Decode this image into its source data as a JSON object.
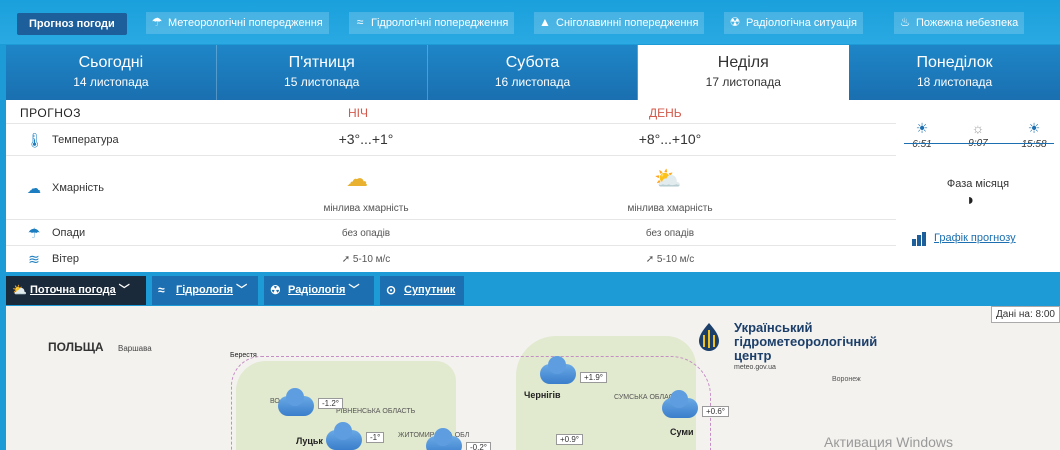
{
  "top_nav": {
    "active_label": "Прогноз погоди",
    "warnings": [
      {
        "label": "Метеорологічні попередження",
        "icon": "weather-warning-icon"
      },
      {
        "label": "Гідрологічні попередження",
        "icon": "hydro-warning-icon"
      },
      {
        "label": "Сніголавинні попередження",
        "icon": "avalanche-warning-icon"
      },
      {
        "label": "Радіологічна ситуація",
        "icon": "radiation-icon"
      },
      {
        "label": "Пожежна небезпека",
        "icon": "fire-danger-icon"
      }
    ]
  },
  "days": [
    {
      "name": "Сьогодні",
      "date": "14 листопада"
    },
    {
      "name": "П'ятниця",
      "date": "15 листопада"
    },
    {
      "name": "Субота",
      "date": "16 листопада"
    },
    {
      "name": "Неділя",
      "date": "17 листопада"
    },
    {
      "name": "Понеділок",
      "date": "18 листопада"
    }
  ],
  "selected_day_index": 3,
  "forecast": {
    "label": "ПРОГНОЗ",
    "night_label": "НІЧ",
    "day_label": "ДЕНЬ",
    "rows": {
      "temperature": {
        "name": "Температура",
        "night": "+3°...+1°",
        "day": "+8°...+10°"
      },
      "cloudiness": {
        "name": "Хмарність",
        "night": "мінлива хмарність",
        "day": "мінлива хмарність"
      },
      "precipitation": {
        "name": "Опади",
        "night": "без опадів",
        "day": "без опадів"
      },
      "wind": {
        "name": "Вітер",
        "night": "5-10 м/с",
        "day": "5-10 м/с"
      }
    },
    "sun": {
      "sunrise": "6:51",
      "day_length": "9:07",
      "sunset": "15:58"
    },
    "moon_label": "Фаза місяця",
    "chart_link": "Графік прогнозу"
  },
  "map_tabs": [
    {
      "label": "Поточна погода",
      "icon": "weather-icon"
    },
    {
      "label": "Гідрологія",
      "icon": "waves-icon"
    },
    {
      "label": "Радіологія",
      "icon": "radiation-icon"
    },
    {
      "label": "Супутник",
      "icon": "satellite-icon"
    }
  ],
  "map": {
    "country": "ПОЛЬЩА",
    "capital": "Варшава",
    "org_name": "Український гідрометеорологічний центр",
    "org_site": "meteo.gov.ua",
    "data_label": "Дані на: 8:00",
    "watermark": "Активация Windows",
    "cities": [
      "Берестя",
      "Луцьк",
      "Чернігів",
      "Суми",
      "Воронеж"
    ],
    "regions": [
      "РІВНЕНСЬКА ОБЛАСТЬ",
      "ЖИТОМИРСЬКА ОБЛ",
      "СУМСЬКА ОБЛАСТЬ",
      "ВО"
    ],
    "temps": [
      "+1.9°",
      "-1.2°",
      "-1°",
      "-0.2°",
      "+0.9°",
      "+0.6°"
    ]
  },
  "colors": {
    "top_bg": "#1d9bd6",
    "tab_bg": "#1a6fb0",
    "accent_red": "#d2594b",
    "link": "#1c6fb0"
  }
}
